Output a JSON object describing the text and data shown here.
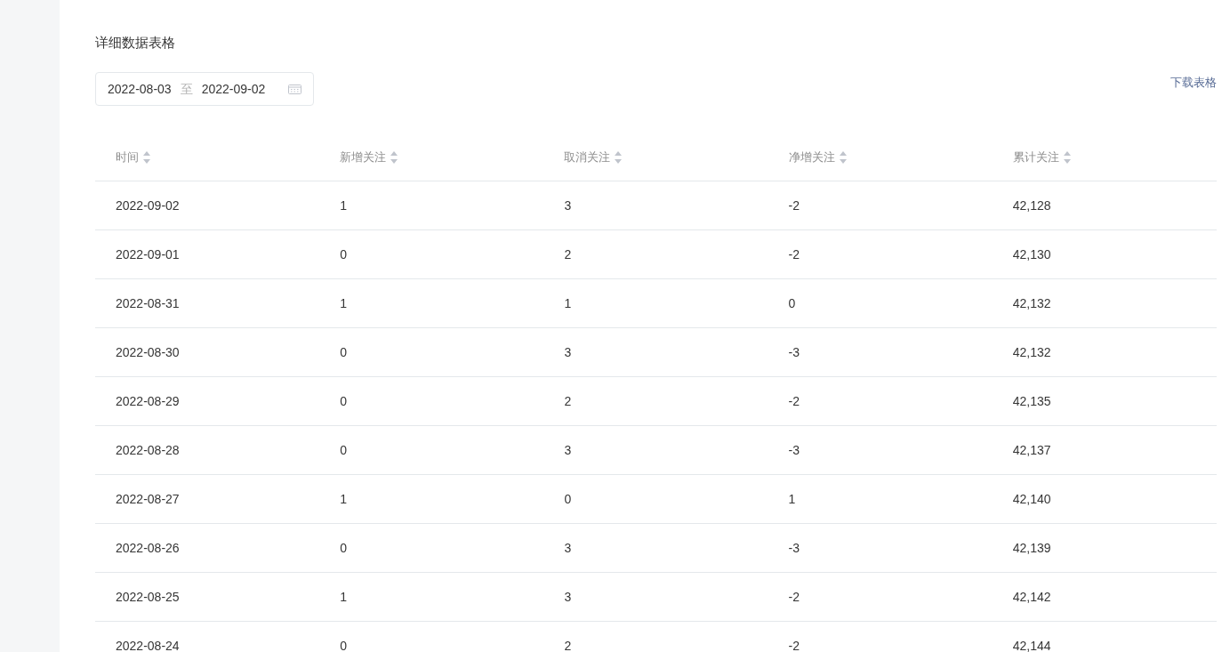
{
  "section_title": "详细数据表格",
  "date_range": {
    "start": "2022-08-03",
    "separator": "至",
    "end": "2022-09-02"
  },
  "download_link": "下载表格",
  "table": {
    "columns": [
      "时间",
      "新增关注",
      "取消关注",
      "净增关注",
      "累计关注"
    ],
    "rows": [
      {
        "cells": [
          "2022-09-02",
          "1",
          "3",
          "-2",
          "42,128"
        ]
      },
      {
        "cells": [
          "2022-09-01",
          "0",
          "2",
          "-2",
          "42,130"
        ]
      },
      {
        "cells": [
          "2022-08-31",
          "1",
          "1",
          "0",
          "42,132"
        ]
      },
      {
        "cells": [
          "2022-08-30",
          "0",
          "3",
          "-3",
          "42,132"
        ]
      },
      {
        "cells": [
          "2022-08-29",
          "0",
          "2",
          "-2",
          "42,135"
        ]
      },
      {
        "cells": [
          "2022-08-28",
          "0",
          "3",
          "-3",
          "42,137"
        ]
      },
      {
        "cells": [
          "2022-08-27",
          "1",
          "0",
          "1",
          "42,140"
        ]
      },
      {
        "cells": [
          "2022-08-26",
          "0",
          "3",
          "-3",
          "42,139"
        ]
      },
      {
        "cells": [
          "2022-08-25",
          "1",
          "3",
          "-2",
          "42,142"
        ]
      },
      {
        "cells": [
          "2022-08-24",
          "0",
          "2",
          "-2",
          "42,144"
        ]
      }
    ]
  }
}
